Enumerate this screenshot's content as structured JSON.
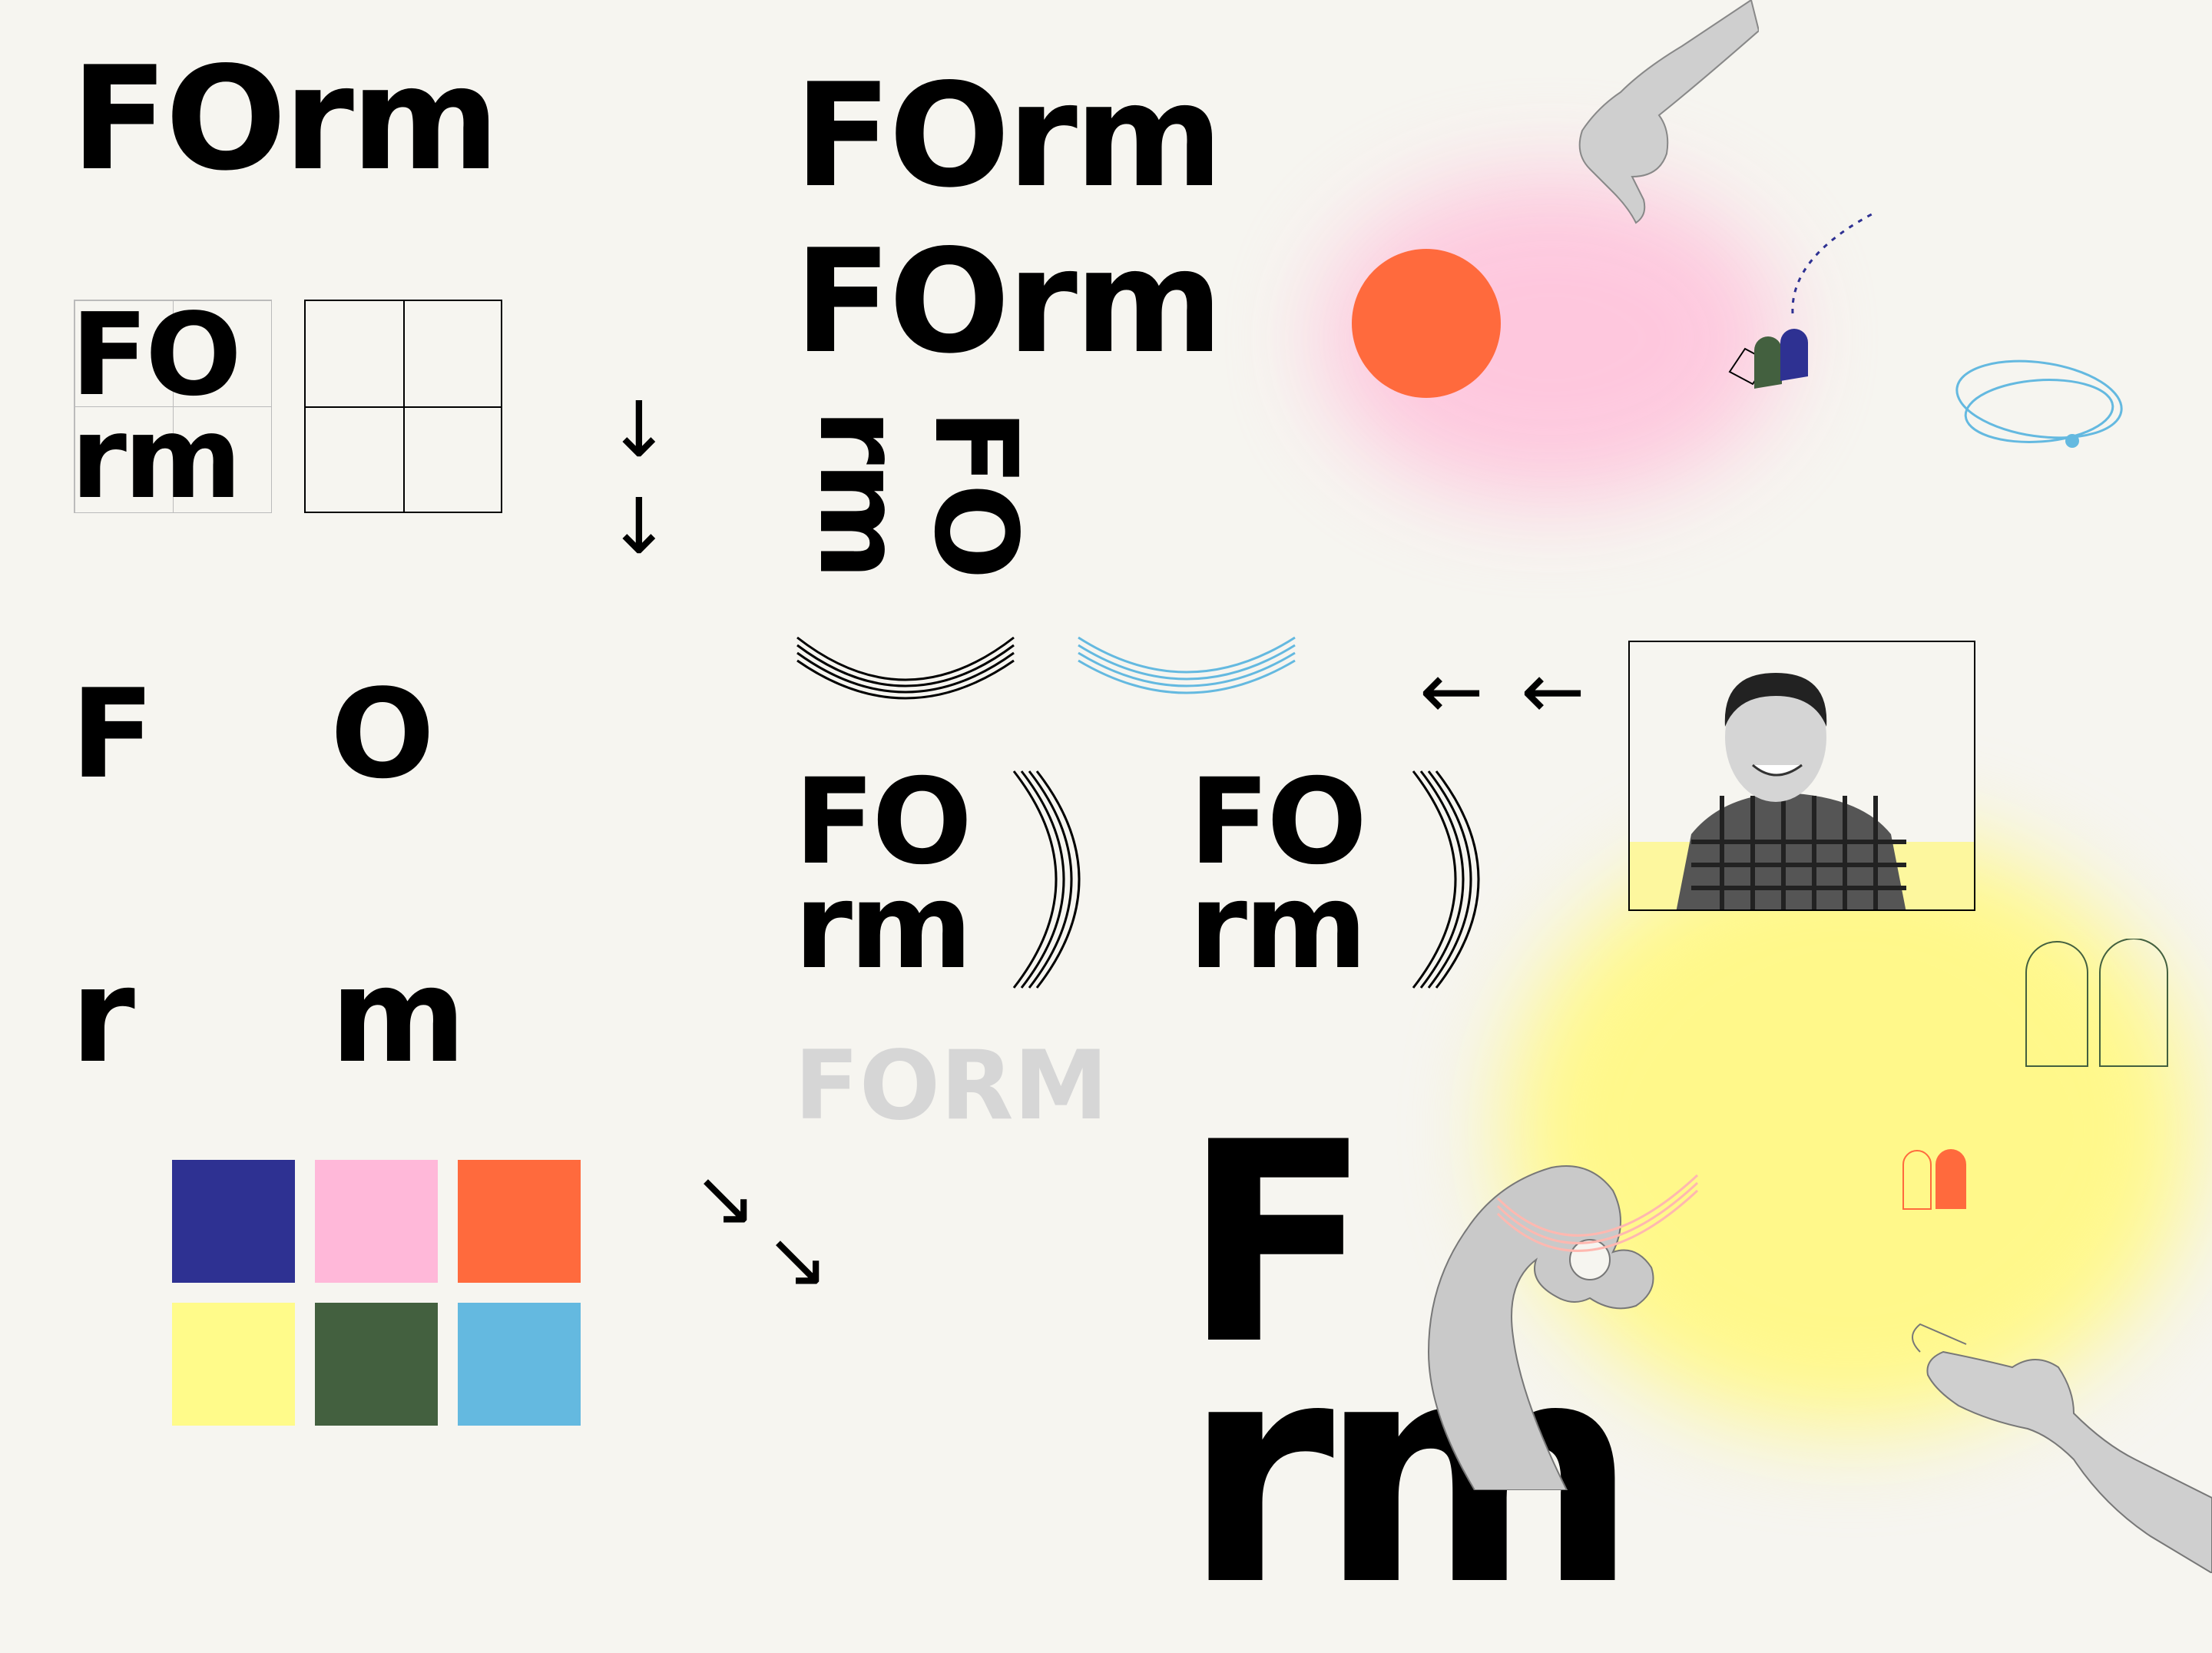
{
  "wordmark": {
    "top_left": "FOrm",
    "stacked_top": "FO",
    "stacked_bottom": "rm",
    "letters": [
      "F",
      "O",
      "r",
      "m"
    ],
    "mid_row1": "FOrm",
    "mid_row2": "FOrm",
    "rotated_top": "FO",
    "rotated_bottom": "rm",
    "stack_a_top": "FO",
    "stack_a_bottom": "rm",
    "stack_b_top": "FO",
    "stack_b_bottom": "rm",
    "ghost": "FORM",
    "large_top": "F",
    "large_bottom": "rm"
  },
  "arrows": {
    "down1": "↓",
    "down2": "↓",
    "left1": "←",
    "left2": "←",
    "diag1": "↘",
    "diag2": "↘"
  },
  "palette": {
    "navy": "#2e3192",
    "pink": "#ffb8d9",
    "orange": "#ff6a3d",
    "yellow": "#fffb8a",
    "green": "#43603f",
    "sky": "#64b9e0"
  },
  "icons": [
    "pinching-hand-icon",
    "reaching-hand-icon",
    "ok-gesture-hand-icon",
    "arch-shapes-icon",
    "orbit-icon",
    "swoosh-lines-icon"
  ]
}
